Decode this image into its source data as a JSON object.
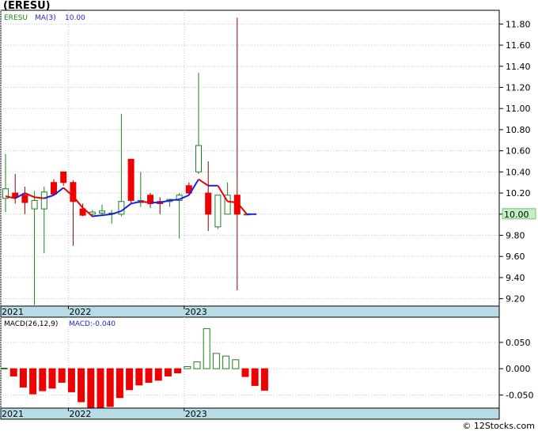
{
  "header": {
    "title": "(ERESU)"
  },
  "footer": {
    "watermark": "© 12Stocks.com"
  },
  "chart_data": [
    {
      "type": "candlestick",
      "panel": "price",
      "legend": {
        "symbol": "ERESU",
        "ma_label": "MA(3)",
        "ma_value": "10.00"
      },
      "last_price_label": "10.00",
      "y_ticks": [
        "11.80",
        "11.60",
        "11.40",
        "11.20",
        "11.00",
        "10.80",
        "10.60",
        "10.40",
        "10.20",
        "10.00",
        "9.80",
        "9.60",
        "9.40",
        "9.20"
      ],
      "ylim": [
        9.13,
        11.93
      ],
      "x_labels": [
        {
          "label": "2021",
          "index": 0
        },
        {
          "label": "2022",
          "index": 7
        },
        {
          "label": "2023",
          "index": 19
        }
      ],
      "candles": [
        {
          "o": 10.15,
          "h": 10.57,
          "l": 10.02,
          "c": 10.24
        },
        {
          "o": 10.2,
          "h": 10.38,
          "l": 10.1,
          "c": 10.16
        },
        {
          "o": 10.18,
          "h": 10.26,
          "l": 10.0,
          "c": 10.11
        },
        {
          "o": 10.05,
          "h": 10.22,
          "l": 9.14,
          "c": 10.13
        },
        {
          "o": 10.05,
          "h": 10.26,
          "l": 9.63,
          "c": 10.21
        },
        {
          "o": 10.3,
          "h": 10.33,
          "l": 10.19,
          "c": 10.19
        },
        {
          "o": 10.4,
          "h": 10.4,
          "l": 10.27,
          "c": 10.3
        },
        {
          "o": 10.3,
          "h": 10.32,
          "l": 9.7,
          "c": 10.12
        },
        {
          "o": 10.05,
          "h": 10.1,
          "l": 9.98,
          "c": 9.99
        },
        {
          "o": 10.0,
          "h": 10.04,
          "l": 9.97,
          "c": 10.02
        },
        {
          "o": 10.01,
          "h": 10.09,
          "l": 9.98,
          "c": 10.03
        },
        {
          "o": 10.01,
          "h": 10.04,
          "l": 9.91,
          "c": 10.01
        },
        {
          "o": 10.0,
          "h": 10.95,
          "l": 9.98,
          "c": 10.12
        },
        {
          "o": 10.52,
          "h": 10.52,
          "l": 10.1,
          "c": 10.13
        },
        {
          "o": 10.11,
          "h": 10.4,
          "l": 10.07,
          "c": 10.13
        },
        {
          "o": 10.18,
          "h": 10.2,
          "l": 10.06,
          "c": 10.1
        },
        {
          "o": 10.12,
          "h": 10.16,
          "l": 10.0,
          "c": 10.1
        },
        {
          "o": 10.12,
          "h": 10.14,
          "l": 10.07,
          "c": 10.14
        },
        {
          "o": 10.13,
          "h": 10.2,
          "l": 9.77,
          "c": 10.18
        },
        {
          "o": 10.27,
          "h": 10.3,
          "l": 10.18,
          "c": 10.2
        },
        {
          "o": 10.4,
          "h": 11.34,
          "l": 10.38,
          "c": 10.65
        },
        {
          "o": 10.2,
          "h": 10.5,
          "l": 9.84,
          "c": 10.0
        },
        {
          "o": 9.88,
          "h": 10.0,
          "l": 9.86,
          "c": 10.18
        },
        {
          "o": 10.0,
          "h": 10.3,
          "l": 10.0,
          "c": 10.18
        },
        {
          "o": 10.18,
          "h": 11.86,
          "l": 9.28,
          "c": 10.0
        },
        {
          "o": 10.0,
          "h": 10.01,
          "l": 9.99,
          "c": 10.0
        }
      ],
      "ma3": [
        10.17,
        10.15,
        10.2,
        10.16,
        10.15,
        10.18,
        10.25,
        10.17,
        10.06,
        9.98,
        9.99,
        10.0,
        10.03,
        10.1,
        10.12,
        10.11,
        10.11,
        10.13,
        10.14,
        10.18,
        10.33,
        10.27,
        10.27,
        10.12,
        10.11,
        10.0,
        10.0
      ],
      "ma3_color_up": "#1f1fdd",
      "ma3_color_down": "#ee0000"
    },
    {
      "type": "bar",
      "panel": "macd",
      "legend": {
        "label": "MACD(26,12,9)",
        "value_label": "MACD:-0.040"
      },
      "y_ticks": [
        "0.050",
        "0.000",
        "-0.050"
      ],
      "ylim": [
        -0.075,
        0.098
      ],
      "x_labels": [
        {
          "label": "2021",
          "index": 0
        },
        {
          "label": "2022",
          "index": 7
        },
        {
          "label": "2023",
          "index": 19
        }
      ],
      "values": [
        0.001,
        -0.014,
        -0.035,
        -0.048,
        -0.042,
        -0.037,
        -0.026,
        -0.044,
        -0.063,
        -0.075,
        -0.075,
        -0.072,
        -0.055,
        -0.04,
        -0.031,
        -0.026,
        -0.022,
        -0.014,
        -0.008,
        0.004,
        0.013,
        0.076,
        0.029,
        0.024,
        0.017,
        -0.015,
        -0.032,
        -0.041
      ],
      "up_color": "#ffffff",
      "up_border": "#208020",
      "down_color": "#ee0000"
    }
  ]
}
